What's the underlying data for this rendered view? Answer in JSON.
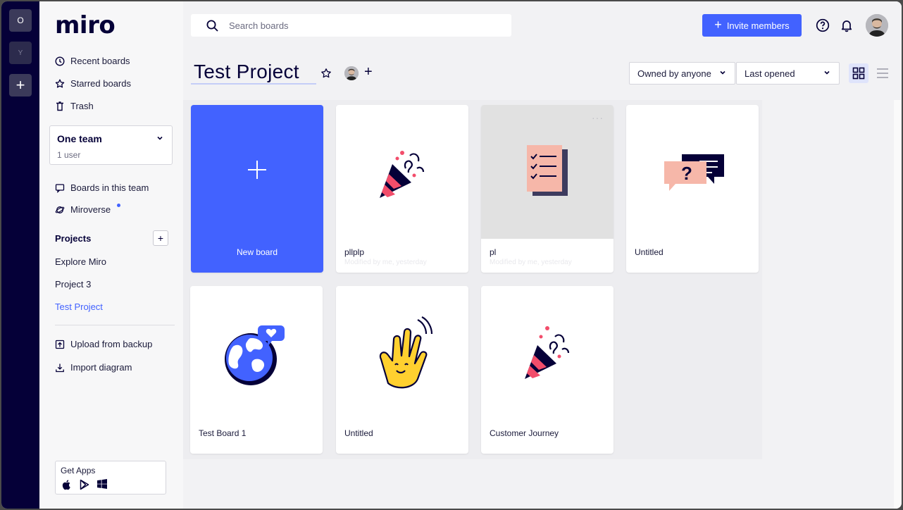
{
  "rail": {
    "teams": [
      {
        "initial": "O"
      },
      {
        "initial": "Y"
      }
    ],
    "add_label": "+"
  },
  "sidebar": {
    "logo": "miro",
    "nav": [
      {
        "label": "Recent boards",
        "icon": "clock-icon"
      },
      {
        "label": "Starred boards",
        "icon": "star-icon"
      },
      {
        "label": "Trash",
        "icon": "trash-icon"
      }
    ],
    "team": {
      "name": "One team",
      "users": "1 user"
    },
    "team_nav": [
      {
        "label": "Boards in this team",
        "icon": "board-icon"
      },
      {
        "label": "Miroverse",
        "icon": "planet-icon"
      }
    ],
    "projects_label": "Projects",
    "projects": [
      {
        "label": "Explore Miro"
      },
      {
        "label": "Project 3"
      },
      {
        "label": "Test Project"
      }
    ],
    "tools": [
      {
        "label": "Upload from backup",
        "icon": "upload-icon"
      },
      {
        "label": "Import diagram",
        "icon": "download-icon"
      }
    ],
    "get_apps": "Get Apps"
  },
  "header": {
    "search_placeholder": "Search boards",
    "invite_label": "Invite members",
    "invite_plus": "+"
  },
  "project": {
    "title": "Test Project",
    "add_member": "+"
  },
  "filters": {
    "owner": "Owned by anyone",
    "sort": "Last opened"
  },
  "boards": [
    {
      "name": "New board",
      "art": "plus"
    },
    {
      "name": "pllplp",
      "sub": "Modified by me, yesterday",
      "art": "party-popper"
    },
    {
      "name": "pl",
      "sub": "Modified by me, yesterday",
      "art": "checklist"
    },
    {
      "name": "Untitled",
      "art": "chat-bubbles"
    },
    {
      "name": "Test Board 1",
      "art": "globe"
    },
    {
      "name": "Untitled",
      "art": "waving-hand"
    },
    {
      "name": "Customer Journey",
      "art": "party-popper"
    }
  ],
  "colors": {
    "accent": "#4262ff",
    "rail": "#050038",
    "ink": "#050038",
    "pink": "#f6b7a9",
    "coral": "#f24d6b",
    "yellow": "#ffd02f"
  }
}
